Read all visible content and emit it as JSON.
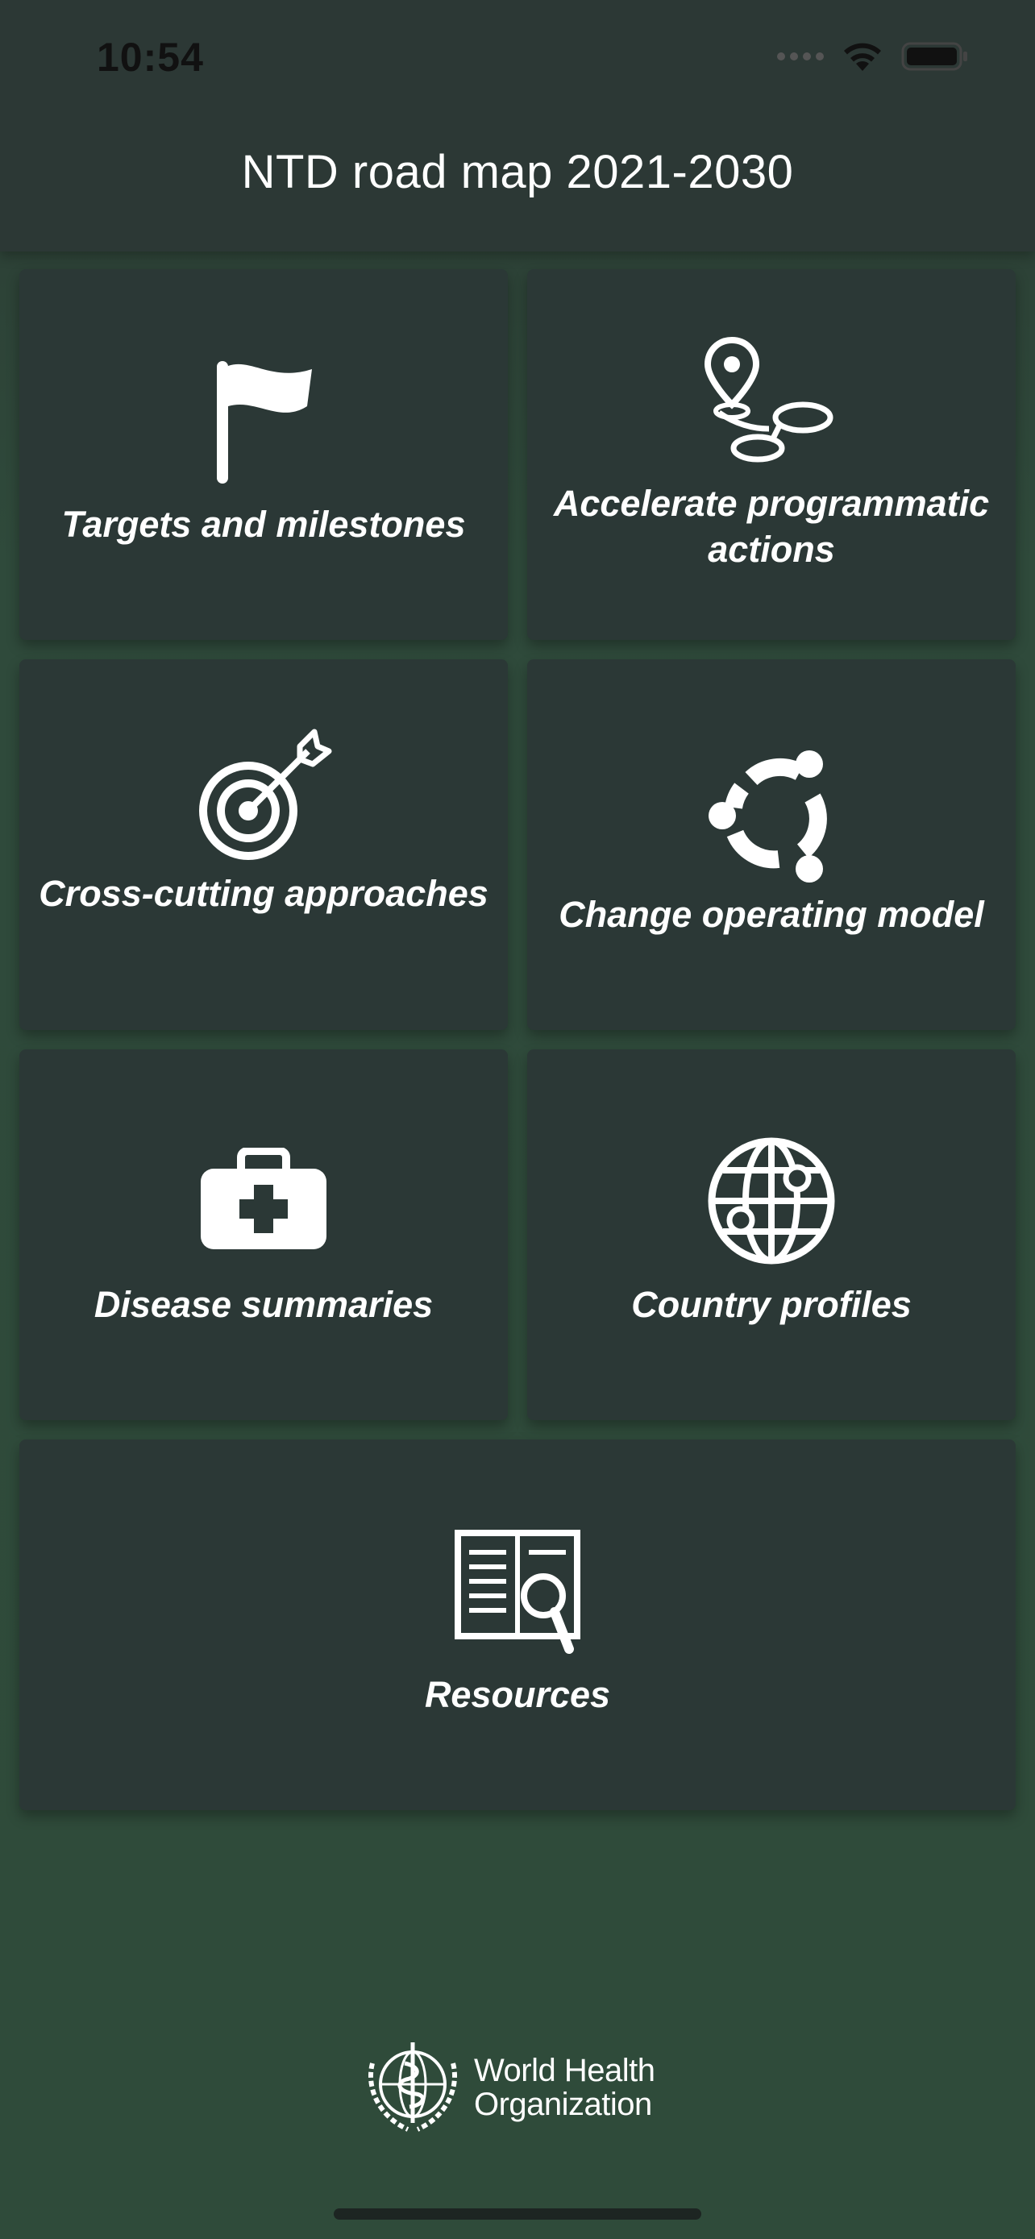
{
  "status_bar": {
    "time": "10:54"
  },
  "header": {
    "title": "NTD road map 2021-2030"
  },
  "tiles": [
    {
      "label": "Targets and milestones",
      "icon": "flag-icon"
    },
    {
      "label": "Accelerate programmatic actions",
      "icon": "route-pin-icon"
    },
    {
      "label": "Cross-cutting approaches",
      "icon": "target-arrow-icon"
    },
    {
      "label": "Change operating model",
      "icon": "cycle-nodes-icon"
    },
    {
      "label": "Disease summaries",
      "icon": "medical-kit-icon"
    },
    {
      "label": "Country profiles",
      "icon": "globe-icon"
    },
    {
      "label": "Resources",
      "icon": "book-search-icon"
    }
  ],
  "footer": {
    "logo_line1": "World Health",
    "logo_line2": "Organization"
  },
  "colors": {
    "background": "#2f4b3a",
    "header": "#2c3835",
    "tile": "#2b3836",
    "text": "#ffffff"
  }
}
